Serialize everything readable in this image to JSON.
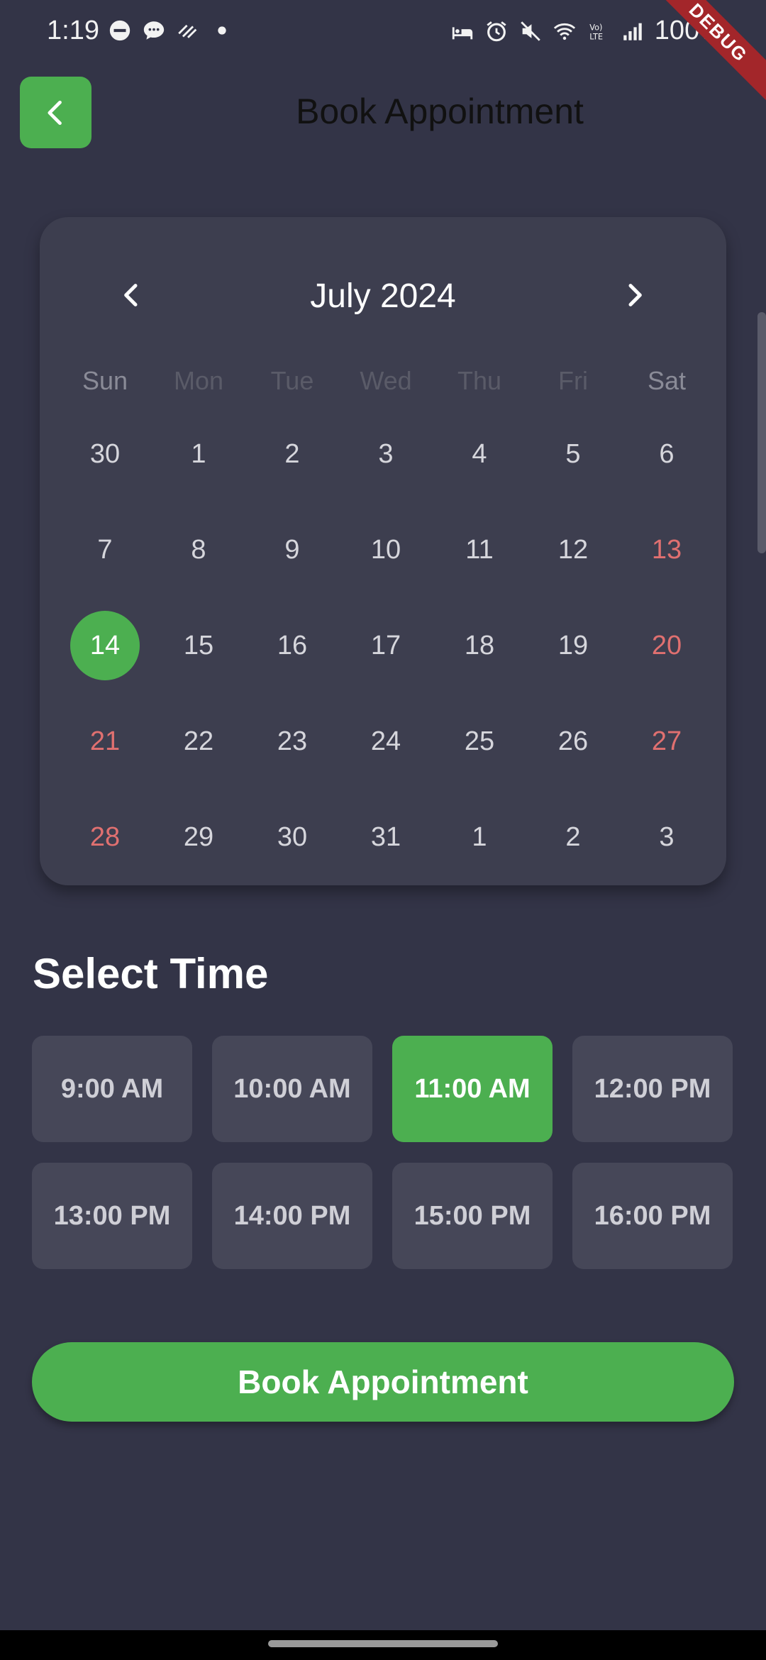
{
  "status_bar": {
    "time": "1:19",
    "battery": "100%",
    "debug_label": "DEBUG"
  },
  "header": {
    "title": "Book Appointment",
    "back_icon": "chevron-left-icon"
  },
  "calendar": {
    "month_label": "July 2024",
    "weekdays": [
      "Sun",
      "Mon",
      "Tue",
      "Wed",
      "Thu",
      "Fri",
      "Sat"
    ],
    "weeks": [
      [
        "30",
        "1",
        "2",
        "3",
        "4",
        "5",
        "6"
      ],
      [
        "7",
        "8",
        "9",
        "10",
        "11",
        "12",
        "13"
      ],
      [
        "14",
        "15",
        "16",
        "17",
        "18",
        "19",
        "20"
      ],
      [
        "21",
        "22",
        "23",
        "24",
        "25",
        "26",
        "27"
      ],
      [
        "28",
        "29",
        "30",
        "31",
        "1",
        "2",
        "3"
      ]
    ],
    "selected_day": "14",
    "selected_color": "#4caf50",
    "weekend_color": "#e07070"
  },
  "time_section": {
    "title": "Select Time",
    "slots": [
      [
        "9:00 AM",
        "10:00 AM",
        "11:00 AM",
        "12:00 PM"
      ],
      [
        "13:00 PM",
        "14:00 PM",
        "15:00 PM",
        "16:00 PM"
      ]
    ],
    "selected_slot": "11:00 AM"
  },
  "actions": {
    "book_label": "Book Appointment"
  },
  "colors": {
    "background": "#333447",
    "accent": "#4caf50",
    "card": "#3d3e4f"
  }
}
